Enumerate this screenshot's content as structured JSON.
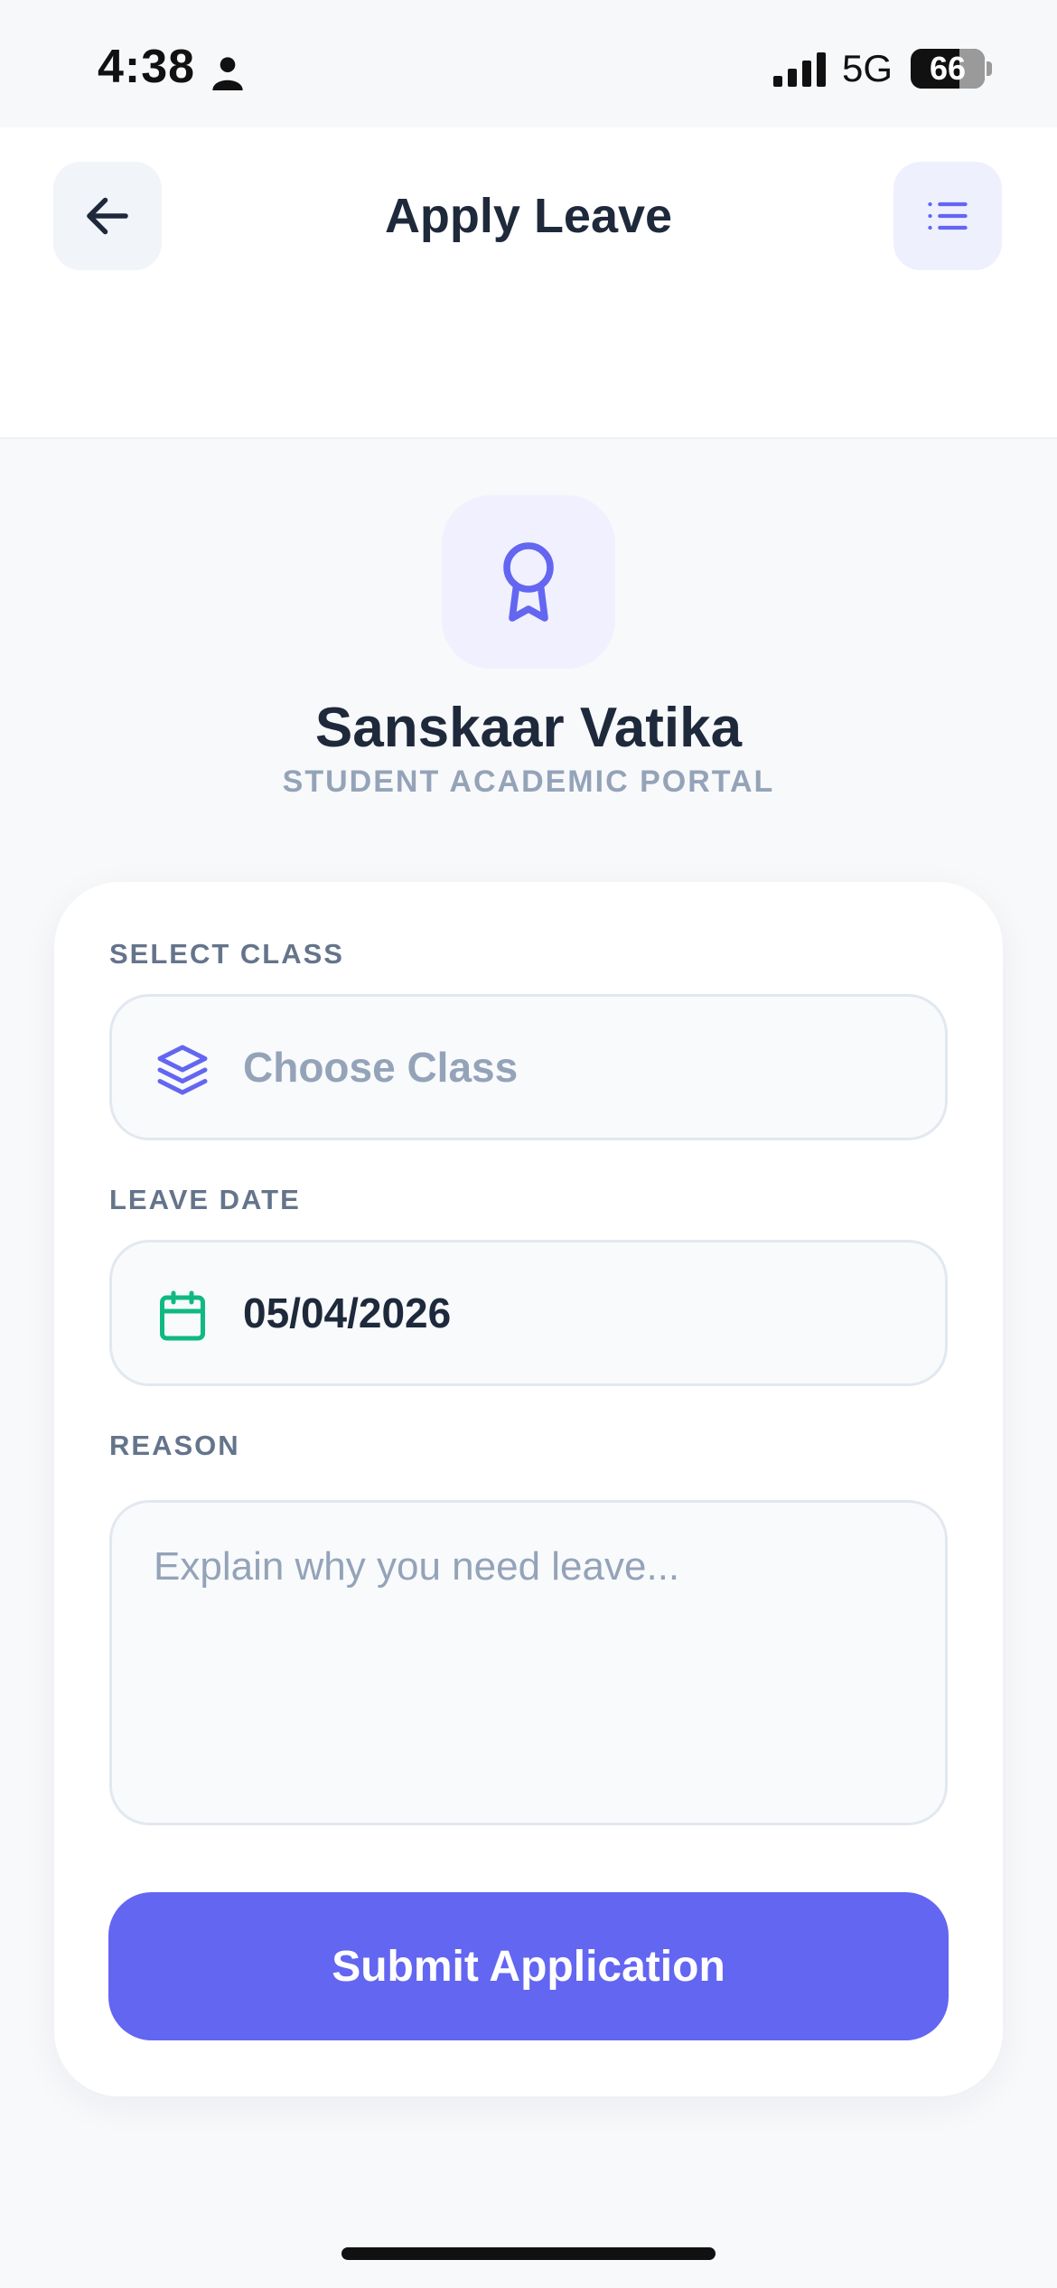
{
  "status_bar": {
    "time": "4:38",
    "network": "5G",
    "battery_level": "66",
    "icons": [
      "person-icon",
      "signal-icon",
      "battery-icon"
    ]
  },
  "header": {
    "title": "Apply Leave",
    "back_icon": "arrow-left-icon",
    "menu_icon": "list-icon"
  },
  "org": {
    "logo_icon": "award-icon",
    "name": "Sanskaar Vatika",
    "subtitle": "STUDENT ACADEMIC PORTAL"
  },
  "form": {
    "class_field": {
      "label": "SELECT CLASS",
      "placeholder": "Choose Class",
      "icon": "layers-icon"
    },
    "date_field": {
      "label": "LEAVE DATE",
      "value": "05/04/2026",
      "icon": "calendar-icon"
    },
    "reason_field": {
      "label": "REASON",
      "placeholder": "Explain why you need leave..."
    },
    "submit_label": "Submit Application"
  },
  "colors": {
    "accent": "#6366F1",
    "accent_soft": "#EEF0FE",
    "calendar_green": "#10B981",
    "title_text": "#1E293B",
    "muted_text": "#94A3B8"
  }
}
